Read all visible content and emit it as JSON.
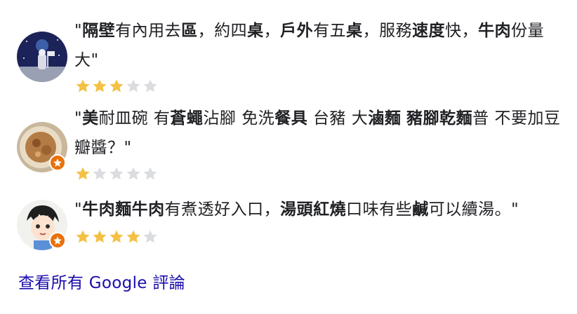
{
  "reviews": [
    {
      "text_parts": [
        {
          "t": "\"",
          "b": false
        },
        {
          "t": "隔壁",
          "b": true
        },
        {
          "t": "有內用去",
          "b": false
        },
        {
          "t": "區",
          "b": true
        },
        {
          "t": "，約四",
          "b": false
        },
        {
          "t": "桌",
          "b": true
        },
        {
          "t": "，",
          "b": false
        },
        {
          "t": "戶外",
          "b": true
        },
        {
          "t": "有五",
          "b": false
        },
        {
          "t": "桌",
          "b": true
        },
        {
          "t": "，服務",
          "b": false
        },
        {
          "t": "速度",
          "b": true
        },
        {
          "t": "快，",
          "b": false
        },
        {
          "t": "牛肉",
          "b": true
        },
        {
          "t": "份量大\"",
          "b": false
        }
      ],
      "rating": 3,
      "max_rating": 5
    },
    {
      "text_parts": [
        {
          "t": "\"",
          "b": false
        },
        {
          "t": "美",
          "b": true
        },
        {
          "t": "耐皿碗 有",
          "b": false
        },
        {
          "t": "蒼蠅",
          "b": true
        },
        {
          "t": "沾腳 免洗",
          "b": false
        },
        {
          "t": "餐具",
          "b": true
        },
        {
          "t": " 台豬 大",
          "b": false
        },
        {
          "t": "滷麵",
          "b": true
        },
        {
          "t": " ",
          "b": false
        },
        {
          "t": "豬腳乾麵",
          "b": true
        },
        {
          "t": "普 不要加豆瓣醬？\"",
          "b": false
        }
      ],
      "rating": 1,
      "max_rating": 5
    },
    {
      "text_parts": [
        {
          "t": "\"",
          "b": false
        },
        {
          "t": "牛肉麵牛肉",
          "b": true
        },
        {
          "t": "有煮透好入口，",
          "b": false
        },
        {
          "t": "湯頭紅燒",
          "b": true
        },
        {
          "t": "口味有些",
          "b": false
        },
        {
          "t": "鹹",
          "b": true
        },
        {
          "t": "可以續湯。\"",
          "b": false
        }
      ],
      "rating": 4,
      "max_rating": 5
    }
  ],
  "footer": {
    "see_all_label": "查看所有 Google 評論"
  },
  "colors": {
    "star_filled": "#f4c144",
    "star_empty": "#dadce0",
    "link": "#1a0dab",
    "badge": "#e8710a"
  },
  "icons": {
    "avatar_1": "astronaut-avatar-icon",
    "avatar_2": "food-photo-avatar-icon",
    "avatar_3": "anime-character-avatar-icon",
    "badge": "local-guide-badge-icon"
  }
}
